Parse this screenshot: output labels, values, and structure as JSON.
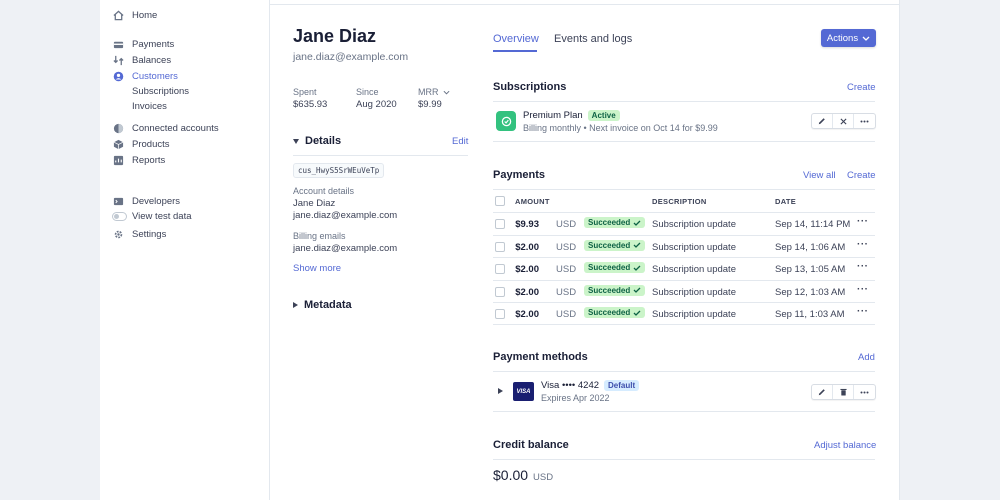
{
  "sidebar": {
    "items": [
      {
        "label": "Home",
        "icon": "home-icon"
      },
      {
        "label": "Payments",
        "icon": "payments-icon"
      },
      {
        "label": "Balances",
        "icon": "balances-icon"
      },
      {
        "label": "Customers",
        "icon": "customers-icon",
        "active": true
      },
      {
        "label": "Subscriptions"
      },
      {
        "label": "Invoices"
      },
      {
        "label": "Connected accounts",
        "icon": "connected-accounts-icon"
      },
      {
        "label": "Products",
        "icon": "products-icon"
      },
      {
        "label": "Reports",
        "icon": "reports-icon"
      },
      {
        "label": "Developers",
        "icon": "developers-icon"
      },
      {
        "label": "View test data",
        "icon": "toggle-icon"
      },
      {
        "label": "Settings",
        "icon": "gear-icon"
      }
    ]
  },
  "customer": {
    "name": "Jane Diaz",
    "email": "jane.diaz@example.com",
    "stats": [
      {
        "label": "Spent",
        "value": "$635.93"
      },
      {
        "label": "Since",
        "value": "Aug 2020"
      },
      {
        "label": "MRR",
        "value": "$9.99"
      }
    ],
    "details_heading": "Details",
    "edit_label": "Edit",
    "id": "cus_HwyS5SrWEuVeTp",
    "account_details_label": "Account details",
    "account_name": "Jane Diaz",
    "account_email": "jane.diaz@example.com",
    "billing_emails_label": "Billing emails",
    "billing_email": "jane.diaz@example.com",
    "show_more": "Show more",
    "metadata_heading": "Metadata"
  },
  "tabs": [
    "Overview",
    "Events and logs"
  ],
  "actions_label": "Actions",
  "subscriptions": {
    "title": "Subscriptions",
    "create": "Create",
    "plan_name": "Premium Plan",
    "status": "Active",
    "billing": "Billing monthly • Next invoice on Oct 14 for $9.99"
  },
  "payments": {
    "title": "Payments",
    "view_all": "View all",
    "create": "Create",
    "headers": [
      "AMOUNT",
      "DESCRIPTION",
      "DATE"
    ],
    "rows": [
      {
        "amount": "$9.93",
        "currency": "USD",
        "status": "Succeeded",
        "description": "Subscription update",
        "date": "Sep 14, 11:14 PM"
      },
      {
        "amount": "$2.00",
        "currency": "USD",
        "status": "Succeeded",
        "description": "Subscription update",
        "date": "Sep 14, 1:06 AM"
      },
      {
        "amount": "$2.00",
        "currency": "USD",
        "status": "Succeeded",
        "description": "Subscription update",
        "date": "Sep 13, 1:05 AM"
      },
      {
        "amount": "$2.00",
        "currency": "USD",
        "status": "Succeeded",
        "description": "Subscription update",
        "date": "Sep 12, 1:03 AM"
      },
      {
        "amount": "$2.00",
        "currency": "USD",
        "status": "Succeeded",
        "description": "Subscription update",
        "date": "Sep 11, 1:03 AM"
      }
    ]
  },
  "payment_methods": {
    "title": "Payment methods",
    "add": "Add",
    "brand": "VISA",
    "card": "Visa •••• 4242",
    "badge": "Default",
    "expires": "Expires Apr 2022"
  },
  "credit_balance": {
    "title": "Credit balance",
    "adjust": "Adjust balance",
    "amount": "$0.00",
    "currency": "USD"
  },
  "colors": {
    "accent": "#5469d4",
    "success_bg": "#cbf4c9",
    "success_text": "#0e6245"
  }
}
